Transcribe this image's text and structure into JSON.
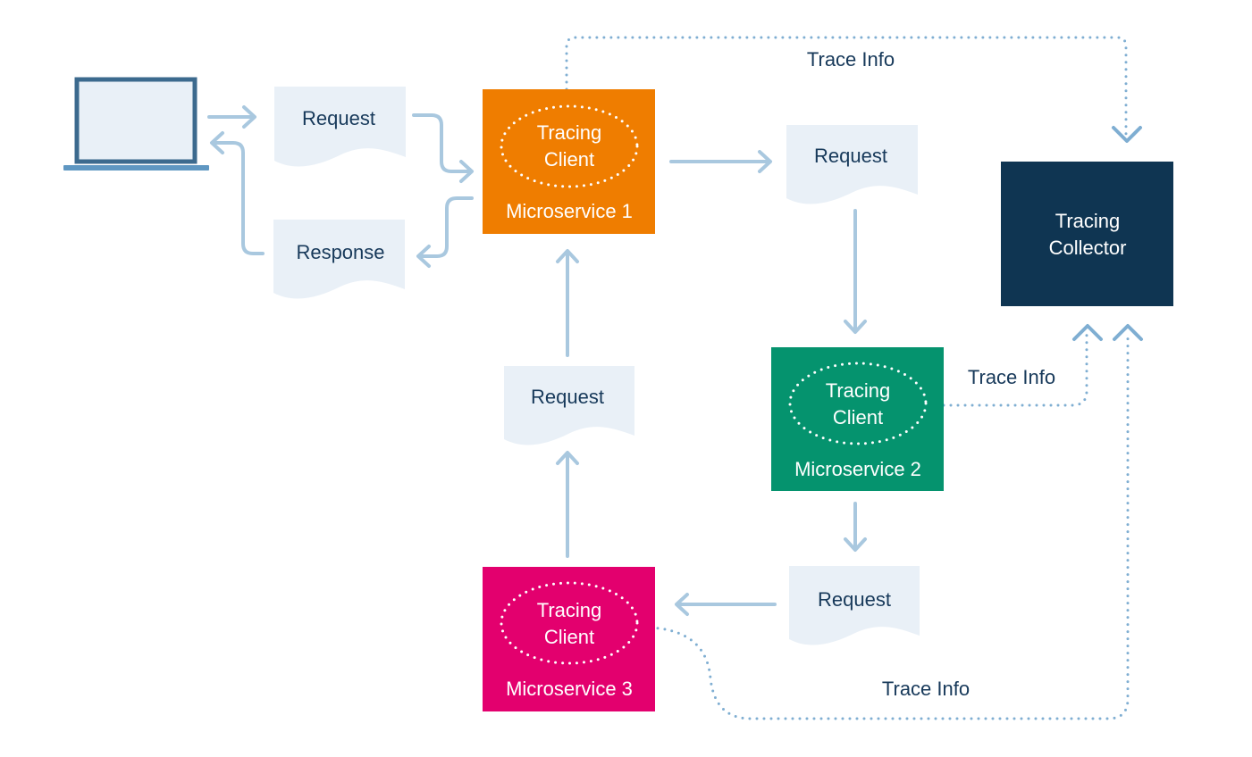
{
  "colors": {
    "microservice_1": "#EF7D00",
    "microservice_2": "#05936E",
    "microservice_3": "#E3006E",
    "tracing_collector": "#0F3552",
    "document": "#E9F0F7",
    "flow_arrow": "#A9C8DF",
    "trace_line": "#7FAED2",
    "text": "#17395A"
  },
  "client": {
    "icon": "laptop-icon"
  },
  "documents": {
    "request_1": "Request",
    "response": "Response",
    "request_2": "Request",
    "request_3": "Request",
    "request_4": "Request"
  },
  "services": {
    "ms1": {
      "client": [
        "Tracing",
        "Client"
      ],
      "name": "Microservice 1"
    },
    "ms2": {
      "client": [
        "Tracing",
        "Client"
      ],
      "name": "Microservice 2"
    },
    "ms3": {
      "client": [
        "Tracing",
        "Client"
      ],
      "name": "Microservice 3"
    }
  },
  "collector": {
    "lines": [
      "Tracing",
      "Collector"
    ]
  },
  "trace_labels": {
    "top": "Trace Info",
    "middle": "Trace Info",
    "bottom": "Trace Info"
  }
}
